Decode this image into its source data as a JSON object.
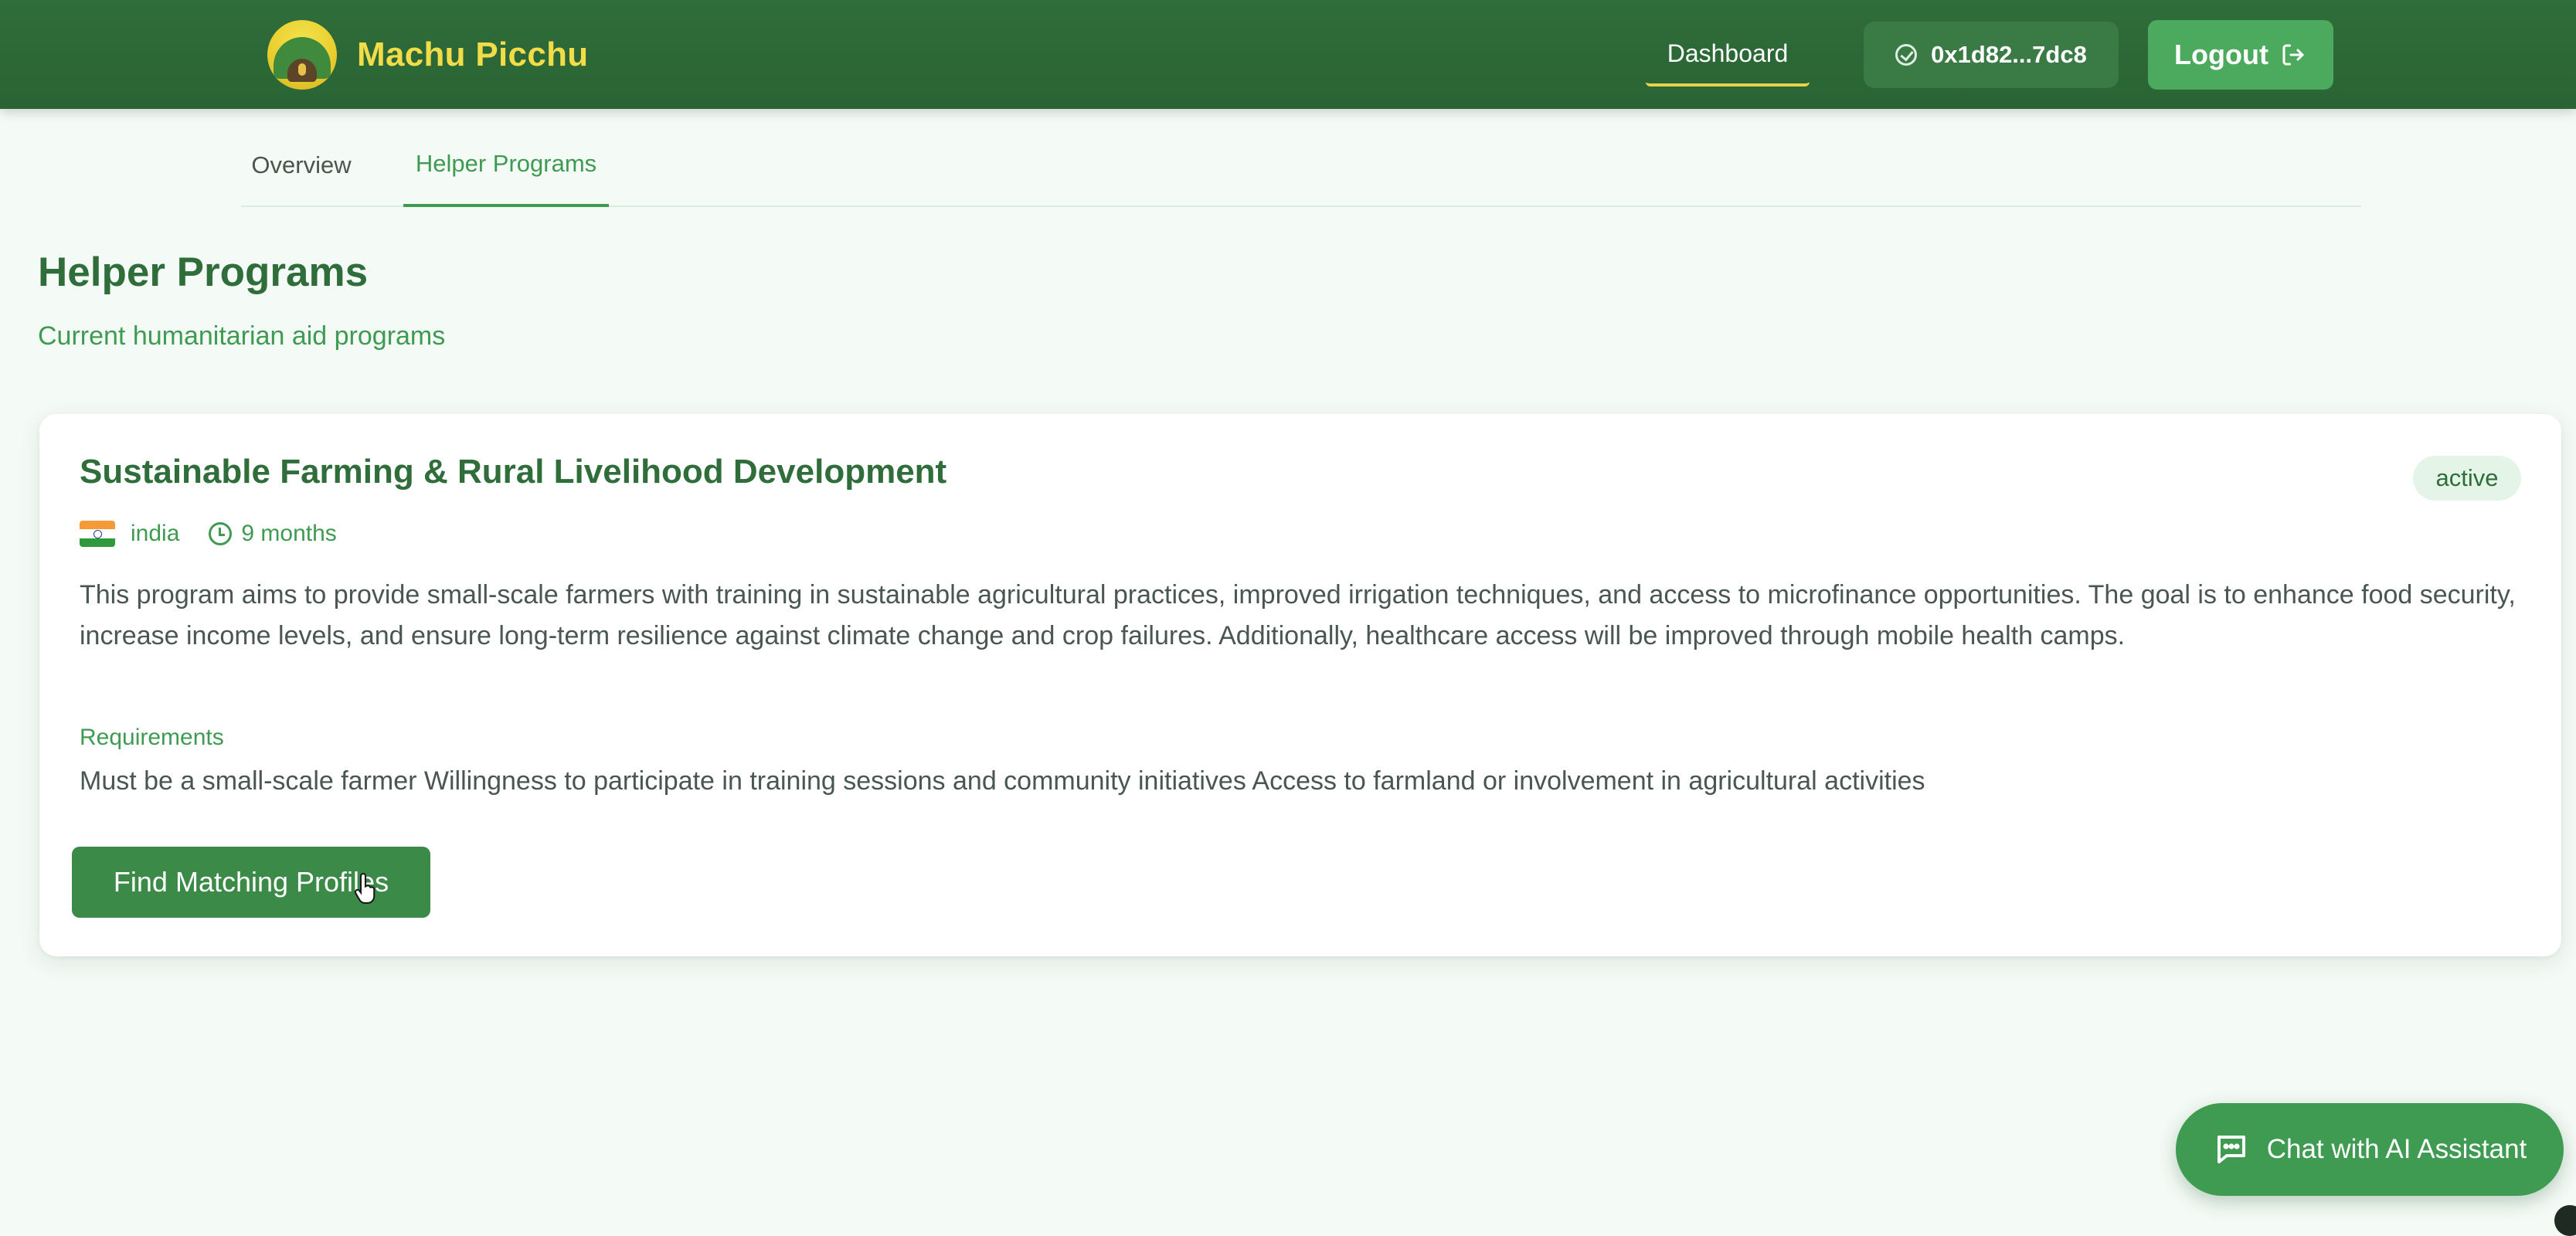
{
  "header": {
    "brand_name": "Machu Picchu",
    "nav_dashboard": "Dashboard",
    "wallet_address": "0x1d82...7dc8",
    "logout_label": "Logout"
  },
  "tabs": [
    {
      "label": "Overview",
      "active": false
    },
    {
      "label": "Helper Programs",
      "active": true
    }
  ],
  "section": {
    "title": "Helper Programs",
    "subtitle": "Current humanitarian aid programs"
  },
  "program": {
    "title": "Sustainable Farming & Rural Livelihood Development",
    "status": "active",
    "country": "india",
    "duration": "9 months",
    "description": "This program aims to provide small-scale farmers with training in sustainable agricultural practices, improved irrigation techniques, and access to microfinance opportunities. The goal is to enhance food security, increase income levels, and ensure long-term resilience against climate change and crop failures. Additionally, healthcare access will be improved through mobile health camps.",
    "requirements_label": "Requirements",
    "requirements": "Must be a small-scale farmer Willingness to participate in training sessions and community initiatives Access to farmland or involvement in agricultural activities",
    "action_label": "Find Matching Profiles"
  },
  "chat": {
    "label": "Chat with AI Assistant"
  },
  "icons": {
    "logo": "mountain-logo-icon",
    "wallet": "check-circle-icon",
    "logout": "logout-icon",
    "flag": "india-flag-icon",
    "duration": "clock-icon",
    "chat": "chat-bubble-icon"
  },
  "colors": {
    "header_bg": "#2f6d3a",
    "brand_text": "#f2dc48",
    "accent_green": "#3f9a52",
    "button_green": "#3b8a47",
    "page_bg": "#f4faf6"
  }
}
